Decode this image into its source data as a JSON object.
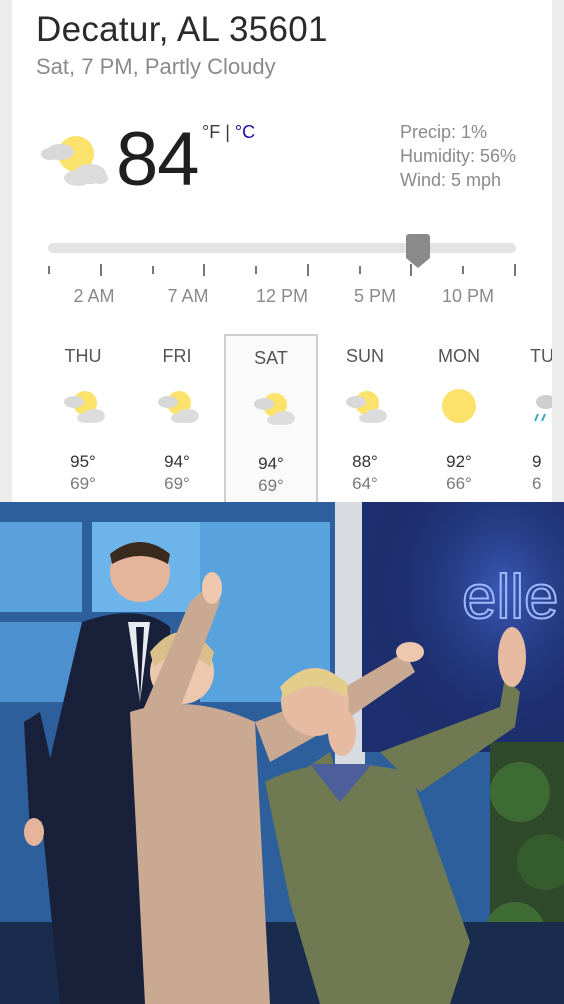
{
  "weather": {
    "location": "Decatur, AL 35601",
    "subtitle": "Sat, 7 PM, Partly Cloudy",
    "temperature": "84",
    "unit_f": "°F",
    "unit_sep": " | ",
    "unit_c": "°C",
    "precip": "Precip: 1%",
    "humidity": "Humidity: 56%",
    "wind": "Wind: 5 mph",
    "current_icon": "partly-cloudy-icon",
    "timeline": {
      "labels": [
        "2 AM",
        "7 AM",
        "12 PM",
        "5 PM",
        "10 PM"
      ],
      "selected_fraction": 0.79
    },
    "forecast": [
      {
        "day": "THU",
        "high": "95°",
        "low": "69°",
        "icon": "partly-cloudy-icon"
      },
      {
        "day": "FRI",
        "high": "94°",
        "low": "69°",
        "icon": "partly-cloudy-icon"
      },
      {
        "day": "SAT",
        "high": "94°",
        "low": "69°",
        "icon": "partly-cloudy-icon"
      },
      {
        "day": "SUN",
        "high": "88°",
        "low": "64°",
        "icon": "partly-cloudy-icon"
      },
      {
        "day": "MON",
        "high": "92°",
        "low": "66°",
        "icon": "sunny-icon"
      },
      {
        "day": "TU",
        "high": "9",
        "low": "6",
        "icon": "rain-icon"
      }
    ]
  },
  "photo": {
    "logo_text": "elle"
  },
  "colors": {
    "sun": "#fbe26a",
    "cloud": "#d6d6d6",
    "unit_link": "#1a0dab",
    "slider_thumb": "#8a8a8a"
  }
}
